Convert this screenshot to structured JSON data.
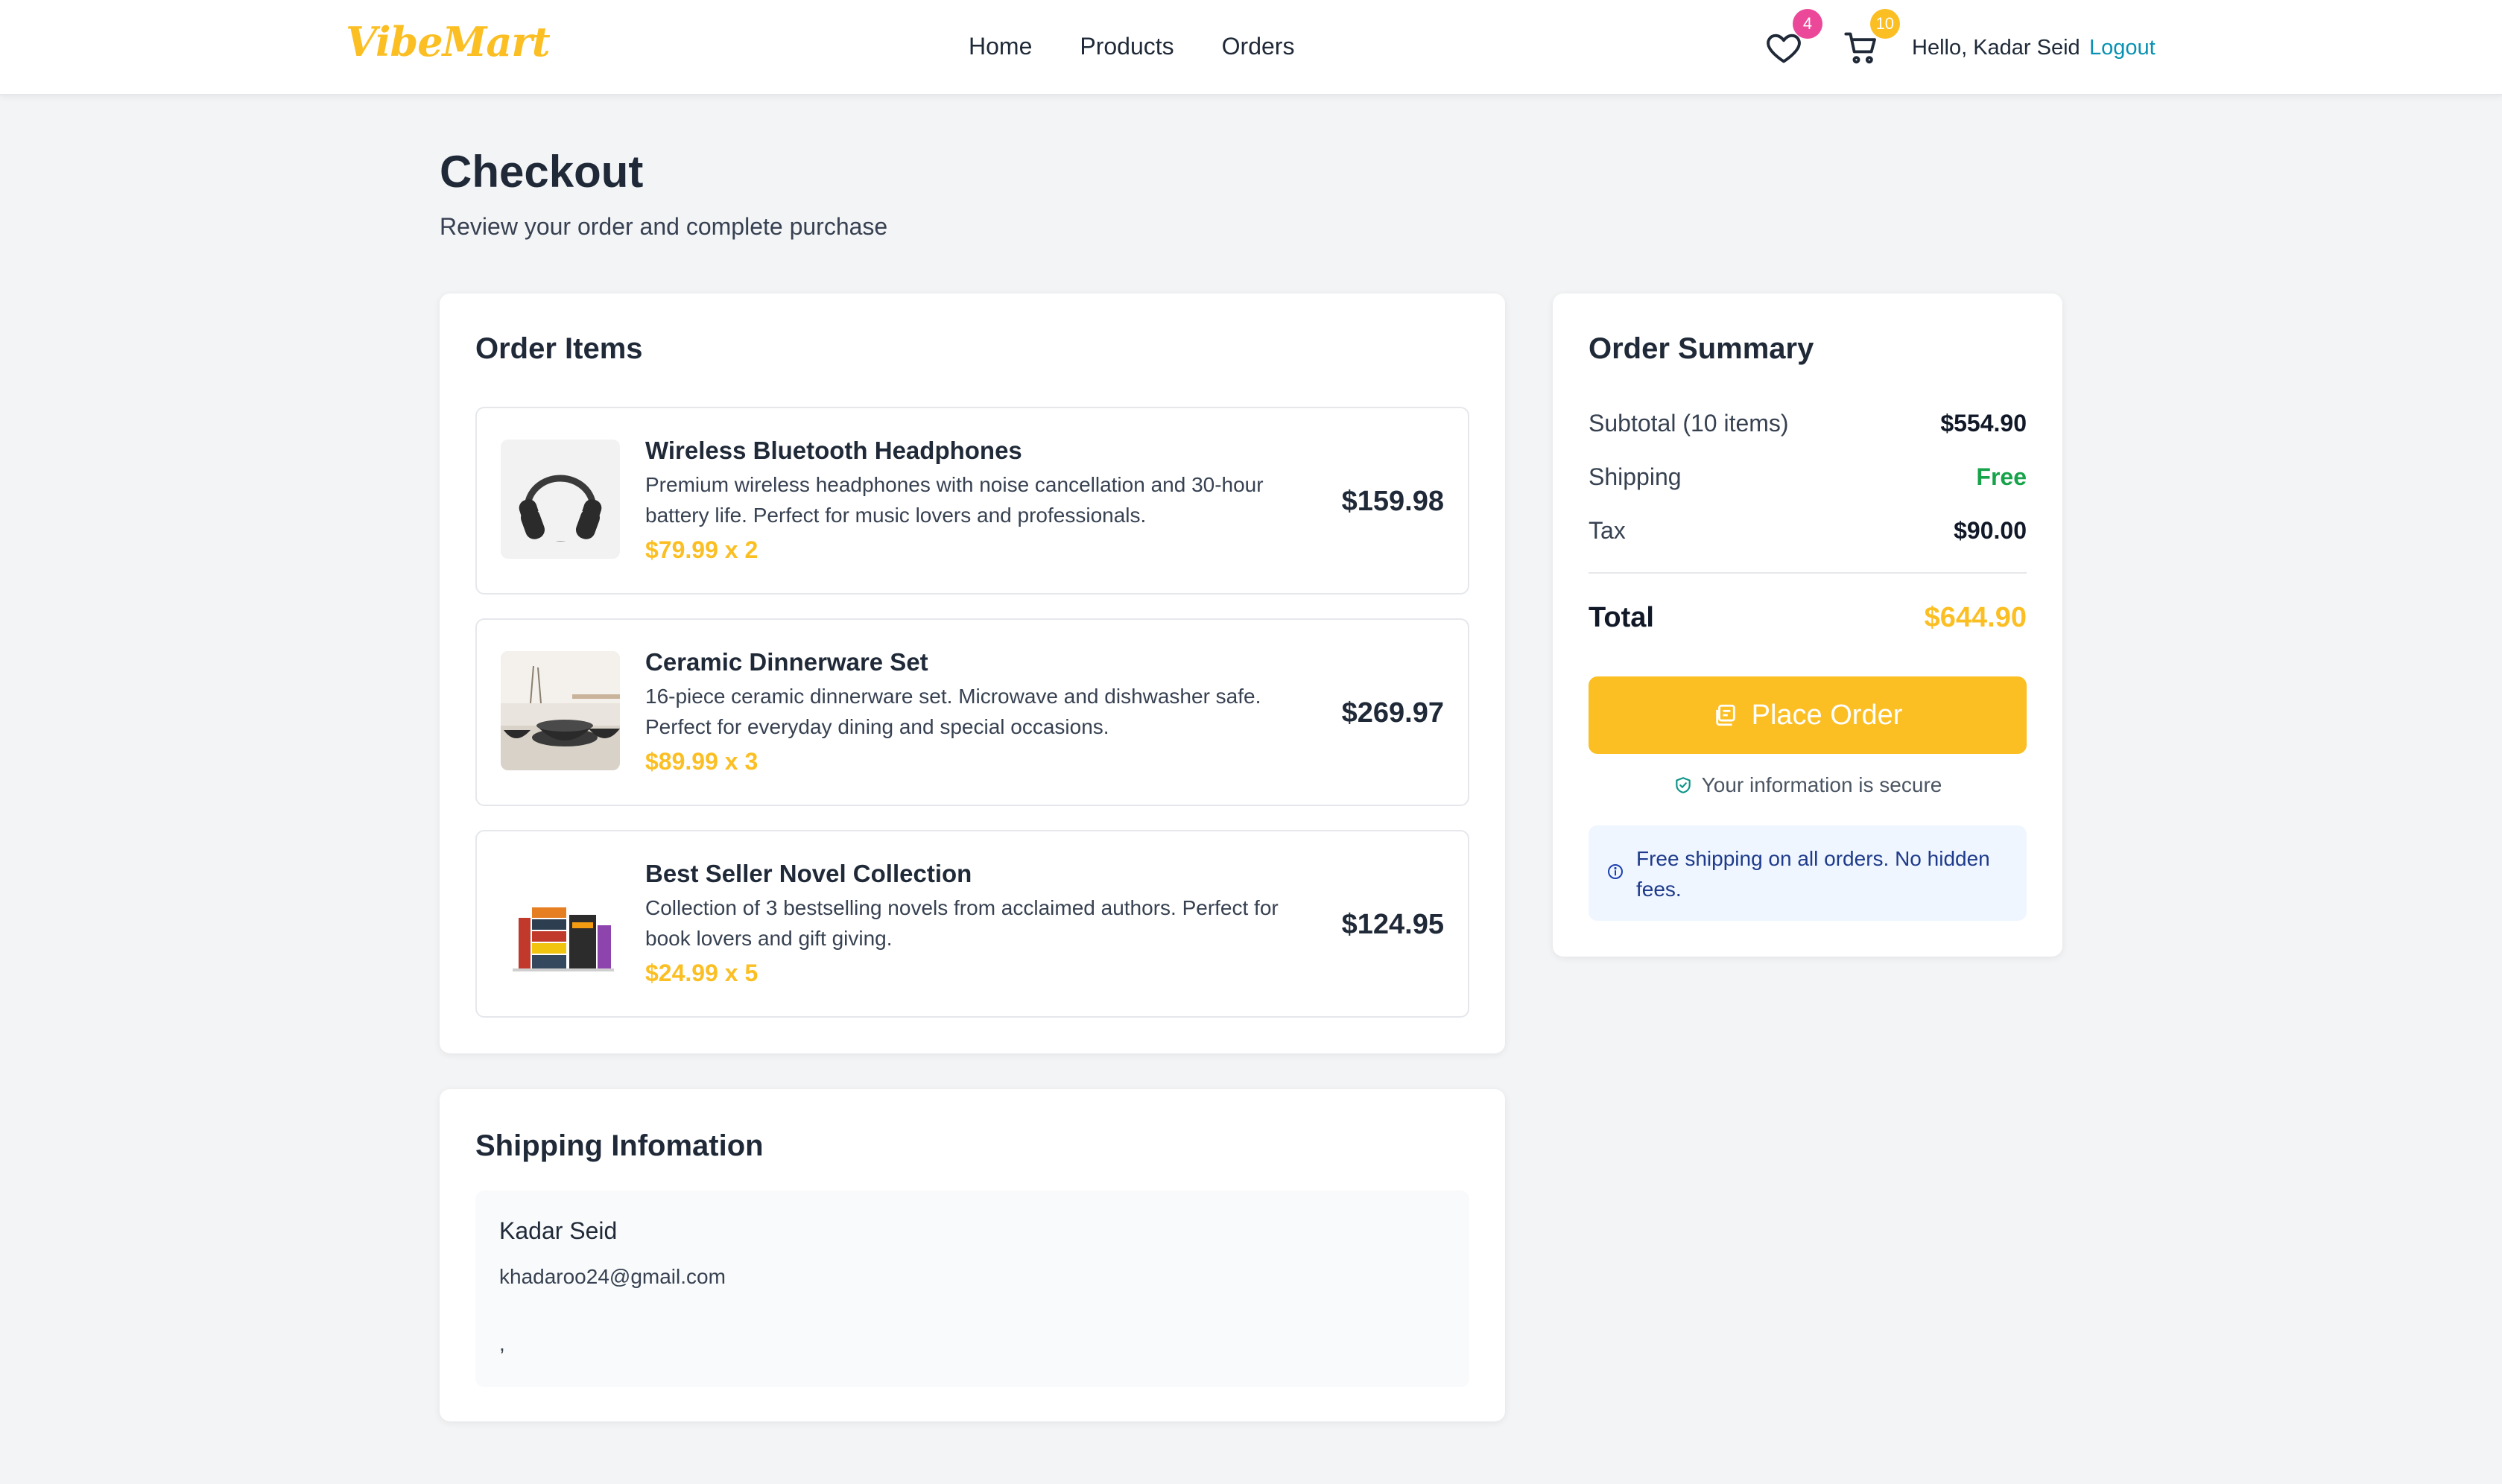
{
  "header": {
    "logo": "VibeMart",
    "nav": [
      "Home",
      "Products",
      "Orders"
    ],
    "wishlist_count": "4",
    "cart_count": "10",
    "greeting": "Hello, Kadar Seid",
    "logout": "Logout",
    "colors": {
      "wishlist_badge": "#ec4899",
      "cart_badge": "#fbbf24",
      "brand": "#fbbf24"
    }
  },
  "page": {
    "title": "Checkout",
    "subtitle": "Review your order and complete purchase"
  },
  "order_items": {
    "title": "Order Items",
    "items": [
      {
        "name": "Wireless Bluetooth Headphones",
        "description": "Premium wireless headphones with noise cancellation and 30-hour battery life. Perfect for music lovers and professionals.",
        "unit_price": "$79.99 x 2",
        "line_total": "$159.98",
        "image_icon": "headphones-image"
      },
      {
        "name": "Ceramic Dinnerware Set",
        "description": "16-piece ceramic dinnerware set. Microwave and dishwasher safe. Perfect for everyday dining and special occasions.",
        "unit_price": "$89.99 x 3",
        "line_total": "$269.97",
        "image_icon": "dinnerware-image"
      },
      {
        "name": "Best Seller Novel Collection",
        "description": "Collection of 3 bestselling novels from acclaimed authors. Perfect for book lovers and gift giving.",
        "unit_price": "$24.99 x 5",
        "line_total": "$124.95",
        "image_icon": "books-image"
      }
    ]
  },
  "shipping": {
    "title": "Shipping Infomation",
    "name": "Kadar Seid",
    "email": "khadaroo24@gmail.com",
    "address": ","
  },
  "summary": {
    "title": "Order Summary",
    "subtotal_label": "Subtotal (10 items)",
    "subtotal_value": "$554.90",
    "shipping_label": "Shipping",
    "shipping_value": "Free",
    "tax_label": "Tax",
    "tax_value": "$90.00",
    "total_label": "Total",
    "total_value": "$644.90",
    "place_order": "Place Order",
    "secure_note": "Your information is secure",
    "info_note": "Free shipping on all orders. No hidden fees."
  }
}
